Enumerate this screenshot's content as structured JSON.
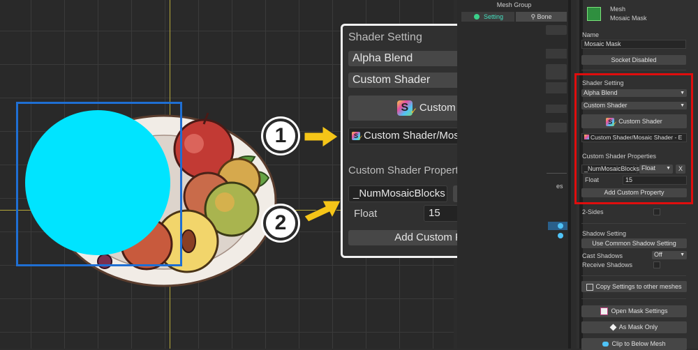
{
  "colors": {
    "accent_red": "#e00d0d",
    "cyan": "#00e4ff",
    "select_blue": "#1f6fd3",
    "arrow_yellow": "#f5c518"
  },
  "callout": {
    "title": "Shader Setting",
    "blend_mode": "Alpha Blend",
    "shader_type": "Custom Shader",
    "custom_shader_button": "Custom Shader",
    "shader_asset": "Custom Shader/Mosaic Shader - E",
    "props_title": "Custom Shader Properties",
    "prop_name": "_NumMosaicBlocks",
    "prop_type": "Float",
    "remove_label": "X",
    "value_label": "Float",
    "value": "15",
    "add_button": "Add Custom Property"
  },
  "badges": {
    "one": "1",
    "two": "2"
  },
  "mid": {
    "header": "Mesh Group",
    "tab_setting": "Setting",
    "tab_bone": "Bone",
    "partial_label": "es"
  },
  "right": {
    "mesh_type": "Mesh",
    "mesh_name_header": "Mosaic Mask",
    "name_label": "Name",
    "name_value": "Mosaic Mask",
    "socket_button": "Socket Disabled",
    "shader_title": "Shader Setting",
    "blend_mode": "Alpha Blend",
    "shader_type": "Custom Shader",
    "custom_shader_button": "Custom Shader",
    "shader_asset": "Custom Shader/Mosaic Shader - E",
    "props_title": "Custom Shader Properties",
    "prop_name": "_NumMosaicBlocks",
    "prop_type": "Float",
    "remove_label": "X",
    "value_label": "Float",
    "value": "15",
    "add_button": "Add Custom Property",
    "two_sides": "2-Sides",
    "shadow_title": "Shadow Setting",
    "common_shadow_button": "Use Common Shadow Setting",
    "cast_shadows": "Cast Shadows",
    "cast_value": "Off",
    "receive_shadows": "Receive Shadows",
    "copy_button": "Copy Settings to other meshes",
    "mask_settings_button": "Open Mask Settings",
    "as_mask_button": "As Mask Only",
    "clip_button": "Clip to Below Mesh"
  }
}
